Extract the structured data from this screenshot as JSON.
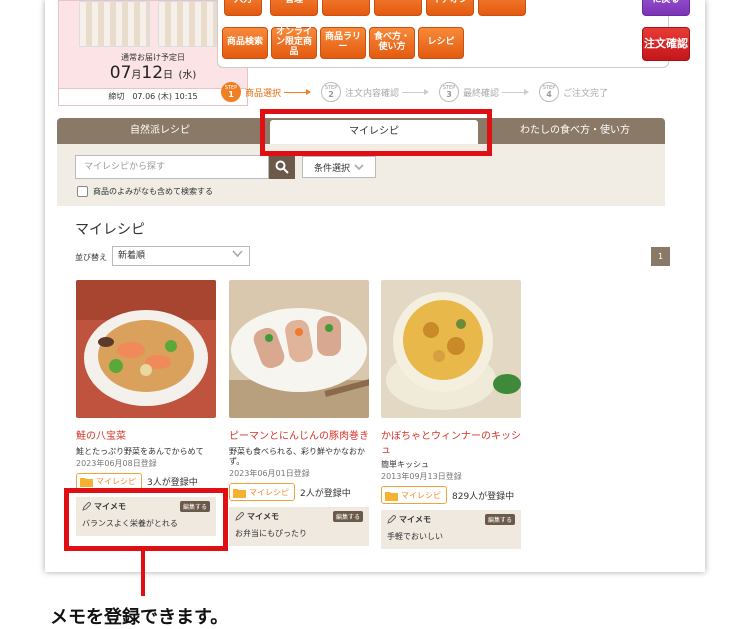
{
  "delivery": {
    "label": "通常お届け予定日",
    "month": "07",
    "month_unit": "月",
    "day": "12",
    "day_unit": "日",
    "weekday": "(水)",
    "deadline": "締切　07.06 (木) 10:15"
  },
  "menu": {
    "top_buttons": [
      "入力",
      "管理",
      "",
      "",
      "イチオシ",
      ""
    ],
    "back": "に戻る",
    "buttons": [
      "商品検索",
      "オンライン限定商品",
      "商品ラリー",
      "食べ方・使い方",
      "レシピ"
    ],
    "order_confirm": "注文確認"
  },
  "steps": [
    {
      "num": "1",
      "label": "商品選択",
      "active": true
    },
    {
      "num": "2",
      "label": "注文内容確認",
      "active": false
    },
    {
      "num": "3",
      "label": "最終確認",
      "active": false
    },
    {
      "num": "4",
      "label": "ご注文完了",
      "active": false
    }
  ],
  "step_prefix": "STEP",
  "tabs": [
    "自然派レシピ",
    "マイレシピ",
    "わたしの食べ方・使い方"
  ],
  "search": {
    "placeholder": "マイレシピから探す",
    "condition": "条件選択",
    "checkbox_label": "商品のよみがなも含めて検索する"
  },
  "section_title": "マイレシピ",
  "sort": {
    "label": "並び替え",
    "value": "新着順"
  },
  "page": "1",
  "my_recipe_label": "マイレシピ",
  "memo_label": "マイメモ",
  "edit_label": "編集する",
  "cards": [
    {
      "title": "鮭の八宝菜",
      "desc": "鮭とたっぷり野菜をあんでからめて",
      "date": "2023年06月08日登録",
      "count": "3人が登録中",
      "memo": "バランスよく栄養がとれる"
    },
    {
      "title": "ピーマンとにんじんの豚肉巻き",
      "desc": "野菜も食べられる、彩り鮮やかなおかず。",
      "date": "2023年06月01日登録",
      "count": "2人が登録中",
      "memo": "お弁当にもぴったり"
    },
    {
      "title": "かぼちゃとウィンナーのキッシュ",
      "desc": "簡単キッシュ",
      "date": "2013年09月13日登録",
      "count": "829人が登録中",
      "memo": "手軽でおいしい"
    }
  ],
  "caption": "メモを登録できます。",
  "colors": {
    "accent": "#e00f14",
    "orange": "#f07f22",
    "tab_brown": "#8a7966",
    "title_red": "#d8332a"
  }
}
